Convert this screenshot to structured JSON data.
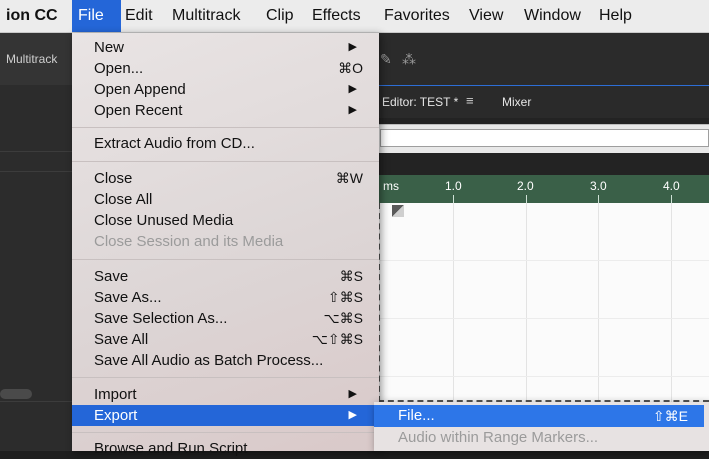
{
  "menubar": {
    "app": "ion CC",
    "items": [
      "File",
      "Edit",
      "Multitrack",
      "Clip",
      "Effects",
      "Favorites",
      "View",
      "Window",
      "Help"
    ]
  },
  "background": {
    "left_tab": "Multitrack",
    "editor_tab": "Editor: TEST *",
    "mixer_tab": "Mixer",
    "ruler": [
      "ms",
      "1.0",
      "2.0",
      "3.0",
      "4.0"
    ]
  },
  "file_menu": {
    "new": "New",
    "open": "Open...",
    "open_shortcut": "⌘O",
    "open_append": "Open Append",
    "open_recent": "Open Recent",
    "extract": "Extract Audio from CD...",
    "close": "Close",
    "close_shortcut": "⌘W",
    "close_all": "Close All",
    "close_unused": "Close Unused Media",
    "close_session": "Close Session and its Media",
    "save": "Save",
    "save_shortcut": "⌘S",
    "save_as": "Save As...",
    "save_as_shortcut": "⇧⌘S",
    "save_selection": "Save Selection As...",
    "save_selection_shortcut": "⌥⌘S",
    "save_all": "Save All",
    "save_all_shortcut": "⌥⇧⌘S",
    "save_batch": "Save All Audio as Batch Process...",
    "import": "Import",
    "export": "Export",
    "browse": "Browse and Run Script"
  },
  "export_menu": {
    "file": "File...",
    "file_shortcut": "⇧⌘E",
    "range": "Audio within Range Markers..."
  },
  "colors": {
    "highlight": "#2466d8",
    "ruler": "#3a6048"
  }
}
